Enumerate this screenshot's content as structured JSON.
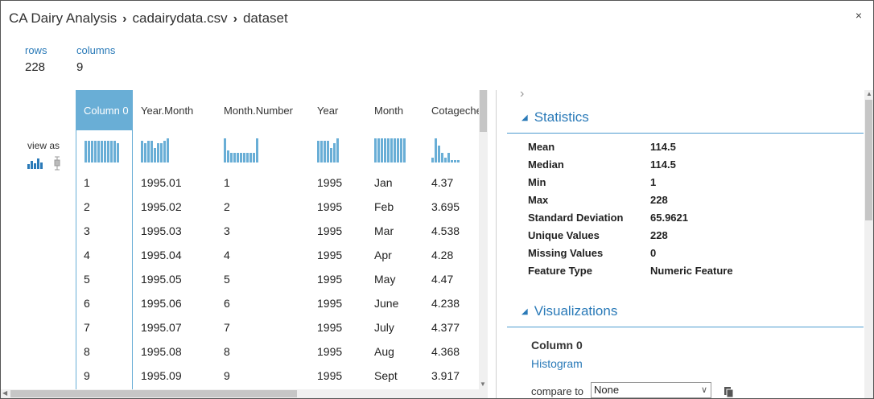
{
  "breadcrumb": [
    "CA Dairy Analysis",
    "cadairydata.csv",
    "dataset"
  ],
  "close_glyph": "×",
  "summary": {
    "rows_label": "rows",
    "rows_value": "228",
    "columns_label": "columns",
    "columns_value": "9"
  },
  "view_as_label": "view as",
  "columns": [
    {
      "header": "Column 0",
      "selected": true,
      "cells": [
        "1",
        "2",
        "3",
        "4",
        "5",
        "6",
        "7",
        "8",
        "9"
      ]
    },
    {
      "header": "Year.Month",
      "cells": [
        "1995.01",
        "1995.02",
        "1995.03",
        "1995.04",
        "1995.05",
        "1995.06",
        "1995.07",
        "1995.08",
        "1995.09"
      ]
    },
    {
      "header": "Month.Number",
      "cells": [
        "1",
        "2",
        "3",
        "4",
        "5",
        "6",
        "7",
        "8",
        "9"
      ]
    },
    {
      "header": "Year",
      "cells": [
        "1995",
        "1995",
        "1995",
        "1995",
        "1995",
        "1995",
        "1995",
        "1995",
        "1995"
      ]
    },
    {
      "header": "Month",
      "cells": [
        "Jan",
        "Feb",
        "Mar",
        "Apr",
        "May",
        "June",
        "July",
        "Aug",
        "Sept"
      ]
    },
    {
      "header": "Cotagechee",
      "cells": [
        "4.37",
        "3.695",
        "4.538",
        "4.28",
        "4.47",
        "4.238",
        "4.377",
        "4.368",
        "3.917"
      ]
    }
  ],
  "sparklines": [
    [
      9,
      9,
      9,
      9,
      9,
      9,
      9,
      9,
      9,
      9,
      8
    ],
    [
      9,
      8,
      9,
      9,
      6,
      8,
      8,
      9,
      10
    ],
    [
      10,
      5,
      4,
      4,
      4,
      4,
      4,
      4,
      4,
      4,
      10
    ],
    [
      9,
      9,
      9,
      9,
      6,
      8,
      10
    ],
    [
      10,
      10,
      10,
      10,
      10,
      10,
      10,
      10,
      10,
      10
    ],
    [
      2,
      10,
      7,
      4,
      2,
      4,
      1,
      1,
      1
    ]
  ],
  "statistics": {
    "title": "Statistics",
    "rows": [
      {
        "label": "Mean",
        "value": "114.5"
      },
      {
        "label": "Median",
        "value": "114.5"
      },
      {
        "label": "Min",
        "value": "1"
      },
      {
        "label": "Max",
        "value": "228"
      },
      {
        "label": "Standard Deviation",
        "value": "65.9621"
      },
      {
        "label": "Unique Values",
        "value": "228"
      },
      {
        "label": "Missing Values",
        "value": "0"
      },
      {
        "label": "Feature Type",
        "value": "Numeric Feature"
      }
    ]
  },
  "visualizations": {
    "title": "Visualizations",
    "column_name": "Column 0",
    "chart_link": "Histogram",
    "compare_label": "compare to",
    "compare_value": "None"
  },
  "colors": {
    "accent": "#2a7ab8",
    "selected_header": "#69aed6",
    "bar": "#69aed6"
  }
}
